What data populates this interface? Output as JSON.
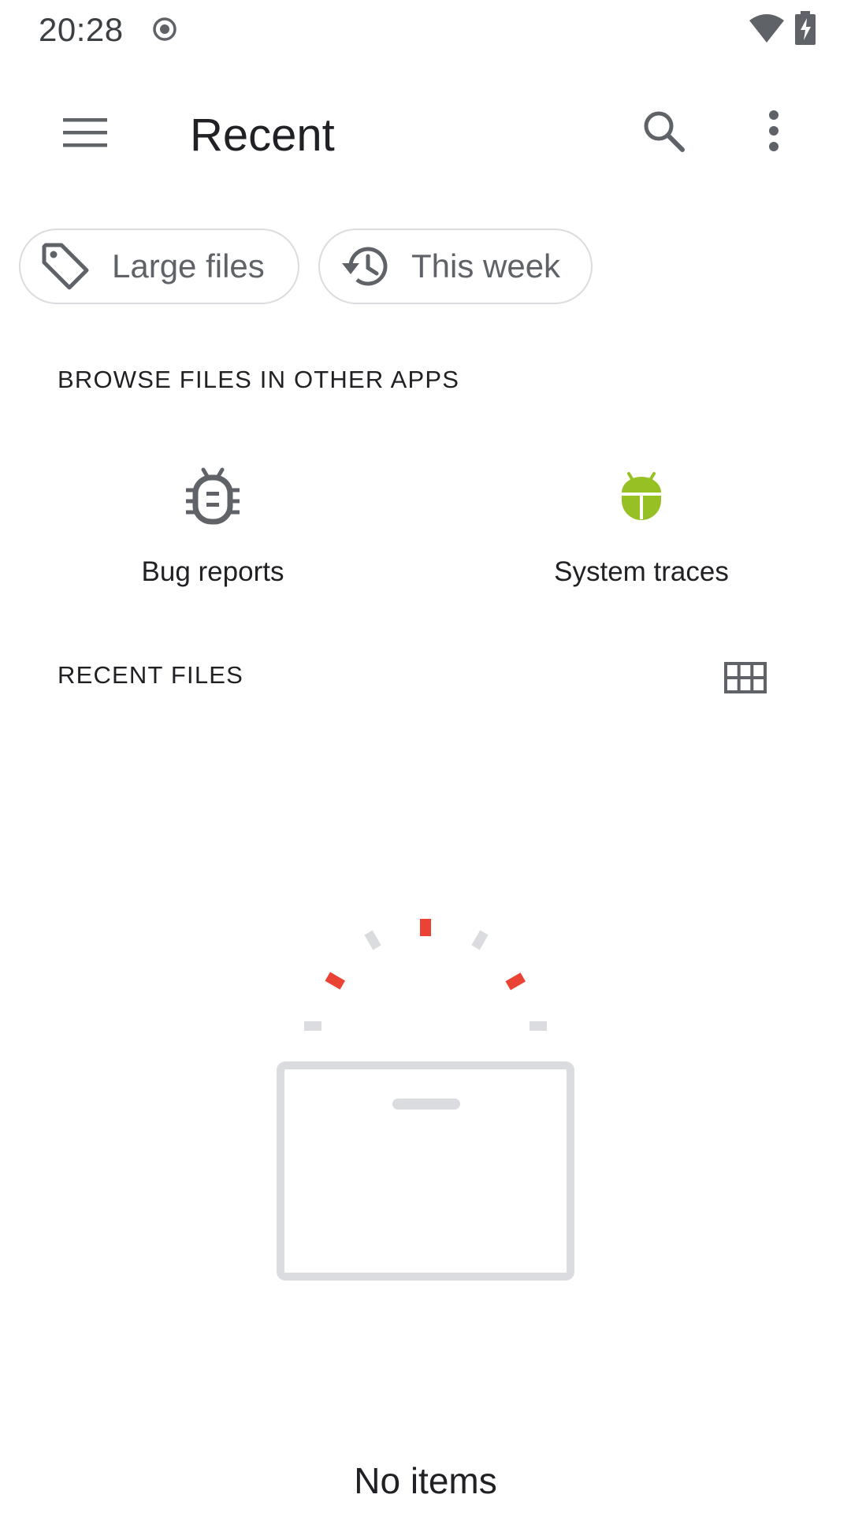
{
  "status_bar": {
    "time": "20:28",
    "icons": [
      "record-icon",
      "wifi-icon",
      "battery-charging-icon"
    ]
  },
  "app_bar": {
    "title": "Recent",
    "icons": [
      "menu-icon",
      "search-icon",
      "more-vert-icon"
    ]
  },
  "chips": [
    {
      "label": "Large files",
      "icon": "tag-icon"
    },
    {
      "label": "This week",
      "icon": "history-icon"
    }
  ],
  "browse_section": {
    "header": "BROWSE FILES IN OTHER APPS",
    "roots": [
      {
        "label": "Bug reports",
        "icon": "bug-icon"
      },
      {
        "label": "System traces",
        "icon": "android-icon"
      }
    ]
  },
  "recent_section": {
    "header": "RECENT FILES",
    "view_toggle_icon": "grid-view-icon"
  },
  "empty_state": {
    "text": "No items",
    "illustration": "empty-box-illustration"
  },
  "colors": {
    "icon_gray": "#5f6368",
    "android_green": "#97c024",
    "accent_red": "#ea4335",
    "illustration_gray": "#dadce0"
  }
}
